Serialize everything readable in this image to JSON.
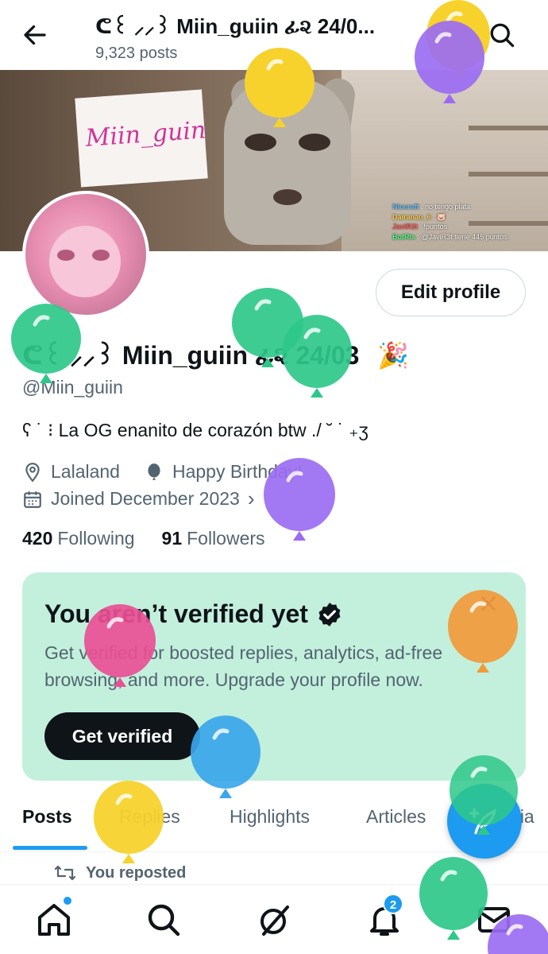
{
  "header": {
    "title": "ᕦ꒰ ⸝⸝꒱ Miin_guiin ፊ૨ 24/0...",
    "posts_count": "9,323 posts",
    "back_icon": "arrow-left-icon",
    "search_icon": "search-icon"
  },
  "banner": {
    "sign_text": "Miin_guin",
    "chat": [
      {
        "user": "Niceraft",
        "text": ": no tengo plata"
      },
      {
        "user": "Dairanao_6",
        "text": ": 🐷"
      },
      {
        "user": "JaviR3t",
        "text": ": !puntos"
      },
      {
        "user": "BotRix",
        "text": ": @JaviR3t tiene 445 puntos."
      }
    ]
  },
  "profile": {
    "edit_button": "Edit profile",
    "display_name": "ᕦ꒰ ⸝⸝꒱ Miin_guiin ፊ૨ 24/03",
    "name_emoji": "🎉",
    "handle": "@Miin_guiin",
    "bio": "ʕ ˙ ⁝ La OG enanito de corazón btw ./ ˘ ˙ ₊ʒ",
    "location": "Lalaland",
    "birthday": "Happy Birthday!",
    "joined": "Joined December 2023",
    "following_count": "420",
    "following_label": "Following",
    "followers_count": "91",
    "followers_label": "Followers"
  },
  "verify_card": {
    "title": "You aren’t verified yet",
    "text": "Get verified for boosted replies, analytics, ad-free browsing, and more. Upgrade your profile now.",
    "button": "Get verified",
    "background": "#c3f0dc"
  },
  "tabs": [
    {
      "label": "Posts",
      "active": true
    },
    {
      "label": "Replies",
      "active": false
    },
    {
      "label": "Highlights",
      "active": false
    },
    {
      "label": "Articles",
      "active": false
    },
    {
      "label": "Media",
      "active": false
    }
  ],
  "repost_label": "You reposted",
  "bottom_nav": {
    "items": [
      "home-icon",
      "search-icon",
      "grok-icon",
      "bell-icon",
      "mail-icon"
    ],
    "notification_count": "2"
  },
  "fab_icon": "compose-feather-icon",
  "colors": {
    "accent": "#1d9bf0",
    "text_primary": "#0f1419",
    "text_secondary": "#536471"
  },
  "balloons": [
    "yellow",
    "purple",
    "yellow",
    "green",
    "green",
    "green",
    "purple",
    "pink",
    "orange",
    "blue",
    "yellow",
    "green",
    "green",
    "purple"
  ]
}
